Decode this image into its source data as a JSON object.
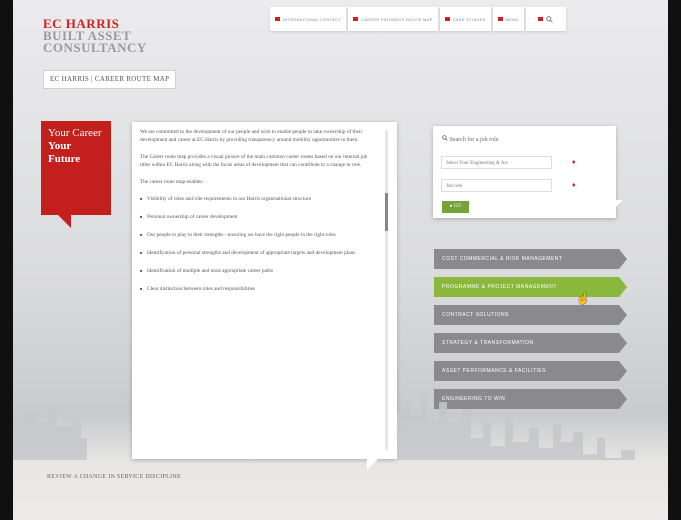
{
  "logo": {
    "line1": "EC HARRIS",
    "line2": "BUILT ASSET",
    "line3": "CONSULTANCY"
  },
  "breadcrumb": "EC HARRIS  |  CAREER ROUTE MAP",
  "topnav": {
    "items": [
      "INTERNATIONAL CONTACT",
      "CAREER PATHWAYS ROUTE MAP",
      "CASE STUDIES",
      "MENU"
    ],
    "search_icon": "magnifier"
  },
  "banner": {
    "line1": "Your Career",
    "line2": "Your Future"
  },
  "panel": {
    "paragraphs": [
      "We are committed to the development of our people and wish to enable people to take ownership of their development and career at EC Harris by providing transparency around mobility opportunities to them.",
      "The Career route map provides a visual picture of the main common career routes based on our internal job titles within EC Harris along with the focus areas of development that can contribute to a change in role.",
      "The career route map enables:"
    ],
    "bullets": [
      "Visibility of roles and role requirements in our Harris organisational structure",
      "Personal ownership of career development",
      "Our people to play to their strengths - ensuring we have the right people in the right roles",
      "Identification of personal strengths and development of appropriate targets and development plans",
      "Identification of multiple and most appropriate career paths",
      "Clear distinction between roles and responsibilities"
    ]
  },
  "job_search": {
    "title": "Search for a job role",
    "business_line": "Select Your Engineering & Arc",
    "job_role": "Job role",
    "go_label": "GO"
  },
  "categories": [
    "COST COMMERCIAL & RISK MANAGEMENT",
    "PROGRAMME & PROJECT MANAGEMENT",
    "CONTRACT SOLUTIONS",
    "STRATEGY & TRANSFORMATION",
    "ASSET PERFORMANCE & FACILITIES",
    "ENGINEERING TO WIN"
  ],
  "active_category_index": 1,
  "footer": "REVIEW A CHANGE IN SERVICE DISCIPLINE",
  "colors": {
    "brand_red": "#c3201d",
    "active_green": "#8ab83c",
    "category_grey": "#8a8a8e"
  }
}
